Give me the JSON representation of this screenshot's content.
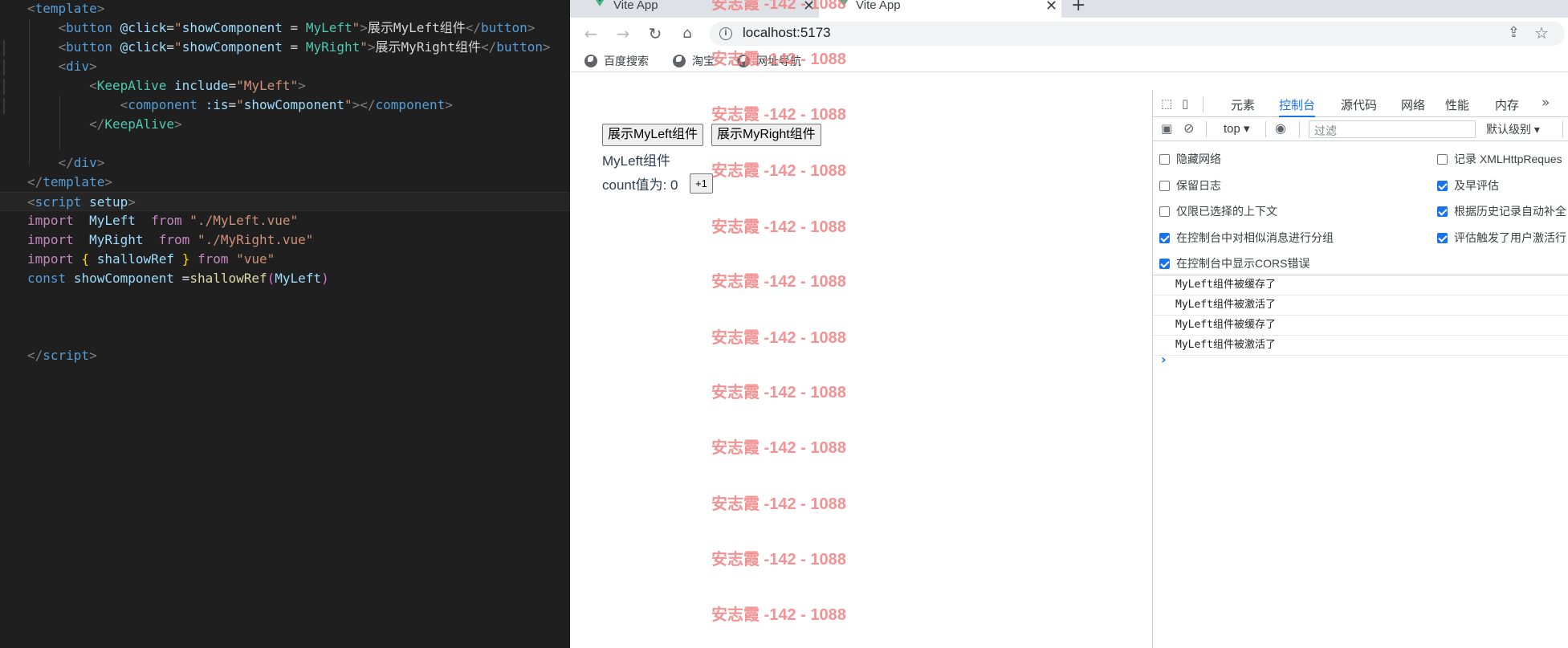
{
  "editor": {
    "lines": [
      {
        "tokens": [
          [
            "t-punc",
            "<"
          ],
          [
            "t-tag",
            "template"
          ],
          [
            "t-punc",
            ">"
          ]
        ]
      },
      {
        "tokens": [
          [
            "t-text",
            "    "
          ],
          [
            "t-punc",
            "<"
          ],
          [
            "t-tag",
            "button "
          ],
          [
            "t-attr",
            "@click"
          ],
          [
            "t-text",
            "="
          ],
          [
            "t-str",
            "\""
          ],
          [
            "t-attr",
            "showComponent"
          ],
          [
            "t-text",
            " = "
          ],
          [
            "t-comp",
            "MyLeft"
          ],
          [
            "t-str",
            "\""
          ],
          [
            "t-punc",
            ">"
          ],
          [
            "t-text",
            "展示MyLeft组件"
          ],
          [
            "t-punc",
            "</"
          ],
          [
            "t-tag",
            "button"
          ],
          [
            "t-punc",
            ">"
          ]
        ]
      },
      {
        "tokens": [
          [
            "t-text",
            "    "
          ],
          [
            "t-punc",
            "<"
          ],
          [
            "t-tag",
            "button "
          ],
          [
            "t-attr",
            "@click"
          ],
          [
            "t-text",
            "="
          ],
          [
            "t-str",
            "\""
          ],
          [
            "t-attr",
            "showComponent"
          ],
          [
            "t-text",
            " = "
          ],
          [
            "t-comp",
            "MyRight"
          ],
          [
            "t-str",
            "\""
          ],
          [
            "t-punc",
            ">"
          ],
          [
            "t-text",
            "展示MyRight组件"
          ],
          [
            "t-punc",
            "</"
          ],
          [
            "t-tag",
            "button"
          ],
          [
            "t-punc",
            ">"
          ]
        ]
      },
      {
        "tokens": [
          [
            "t-text",
            "    "
          ],
          [
            "t-punc",
            "<"
          ],
          [
            "t-tag",
            "div"
          ],
          [
            "t-punc",
            ">"
          ]
        ]
      },
      {
        "tokens": [
          [
            "t-text",
            "        "
          ],
          [
            "t-punc",
            "<"
          ],
          [
            "t-comp",
            "KeepAlive "
          ],
          [
            "t-attr",
            "include"
          ],
          [
            "t-text",
            "="
          ],
          [
            "t-str",
            "\"MyLeft\""
          ],
          [
            "t-punc",
            ">"
          ]
        ]
      },
      {
        "tokens": [
          [
            "t-text",
            "            "
          ],
          [
            "t-punc",
            "<"
          ],
          [
            "t-tag",
            "component "
          ],
          [
            "t-attr",
            ":is"
          ],
          [
            "t-text",
            "="
          ],
          [
            "t-str",
            "\""
          ],
          [
            "t-attr",
            "showComponent"
          ],
          [
            "t-str",
            "\""
          ],
          [
            "t-punc",
            "></"
          ],
          [
            "t-tag",
            "component"
          ],
          [
            "t-punc",
            ">"
          ]
        ]
      },
      {
        "tokens": [
          [
            "t-text",
            "        "
          ],
          [
            "t-punc",
            "</"
          ],
          [
            "t-comp",
            "KeepAlive"
          ],
          [
            "t-punc",
            ">"
          ]
        ]
      },
      {
        "tokens": []
      },
      {
        "tokens": [
          [
            "t-text",
            "    "
          ],
          [
            "t-punc",
            "</"
          ],
          [
            "t-tag",
            "div"
          ],
          [
            "t-punc",
            ">"
          ]
        ]
      },
      {
        "tokens": [
          [
            "t-punc",
            "</"
          ],
          [
            "t-tag",
            "template"
          ],
          [
            "t-punc",
            ">"
          ]
        ]
      },
      {
        "tokens": [
          [
            "t-punc",
            "<"
          ],
          [
            "t-tag",
            "script "
          ],
          [
            "t-attr",
            "setup"
          ],
          [
            "t-punc",
            ">"
          ]
        ]
      },
      {
        "tokens": [
          [
            "t-kw",
            "import"
          ],
          [
            "t-text",
            "  "
          ],
          [
            "t-var",
            "MyLeft"
          ],
          [
            "t-text",
            "  "
          ],
          [
            "t-kw",
            "from"
          ],
          [
            "t-text",
            " "
          ],
          [
            "t-str",
            "\"./MyLeft.vue\""
          ]
        ]
      },
      {
        "tokens": [
          [
            "t-kw",
            "import"
          ],
          [
            "t-text",
            "  "
          ],
          [
            "t-var",
            "MyRight"
          ],
          [
            "t-text",
            "  "
          ],
          [
            "t-kw",
            "from"
          ],
          [
            "t-text",
            " "
          ],
          [
            "t-str",
            "\"./MyRight.vue\""
          ]
        ]
      },
      {
        "tokens": [
          [
            "t-kw",
            "import"
          ],
          [
            "t-text",
            " "
          ],
          [
            "t-brace",
            "{"
          ],
          [
            "t-text",
            " "
          ],
          [
            "t-var",
            "shallowRef"
          ],
          [
            "t-text",
            " "
          ],
          [
            "t-brace",
            "}"
          ],
          [
            "t-text",
            " "
          ],
          [
            "t-kw",
            "from"
          ],
          [
            "t-text",
            " "
          ],
          [
            "t-str",
            "\"vue\""
          ]
        ]
      },
      {
        "tokens": [
          [
            "t-const",
            "const"
          ],
          [
            "t-text",
            " "
          ],
          [
            "t-var",
            "showComponent"
          ],
          [
            "t-text",
            " ="
          ],
          [
            "t-fn",
            "shallowRef"
          ],
          [
            "t-brace2",
            "("
          ],
          [
            "t-var",
            "MyLeft"
          ],
          [
            "t-brace2",
            ")"
          ]
        ]
      },
      {
        "tokens": []
      },
      {
        "tokens": []
      },
      {
        "tokens": []
      },
      {
        "tokens": [
          [
            "t-punc",
            "</"
          ],
          [
            "t-tag",
            "script"
          ],
          [
            "t-punc",
            ">"
          ]
        ]
      }
    ]
  },
  "browser": {
    "tabs": [
      {
        "title": "Vite App"
      },
      {
        "title": "Vite App"
      }
    ],
    "url": "localhost:5173",
    "bookmarks": [
      "百度搜索",
      "淘宝",
      "网址导航"
    ]
  },
  "page": {
    "button_left": "展示MyLeft组件",
    "button_right": "展示MyRight组件",
    "component_title": "MyLeft组件",
    "count_label": "count值为: 0",
    "plus_button": "+1",
    "watermark": "安志霞 -142 - 1088"
  },
  "devtools": {
    "tabs": [
      "元素",
      "控制台",
      "源代码",
      "网络",
      "性能",
      "内存"
    ],
    "active_tab": "控制台",
    "context": "top",
    "filter_placeholder": "过滤",
    "level": "默认级别",
    "options_left": [
      {
        "label": "隐藏网络",
        "checked": false
      },
      {
        "label": "保留日志",
        "checked": false
      },
      {
        "label": "仅限已选择的上下文",
        "checked": false
      },
      {
        "label": "在控制台中对相似消息进行分组",
        "checked": true
      },
      {
        "label": "在控制台中显示CORS错误",
        "checked": true
      }
    ],
    "options_right": [
      {
        "label": "记录 XMLHttpReques",
        "checked": false
      },
      {
        "label": "及早评估",
        "checked": true
      },
      {
        "label": "根据历史记录自动补全",
        "checked": true
      },
      {
        "label": "评估触发了用户激活行",
        "checked": true
      }
    ],
    "logs": [
      "MyLeft组件被缓存了",
      "MyLeft组件被激活了",
      "MyLeft组件被缓存了",
      "MyLeft组件被激活了"
    ]
  }
}
